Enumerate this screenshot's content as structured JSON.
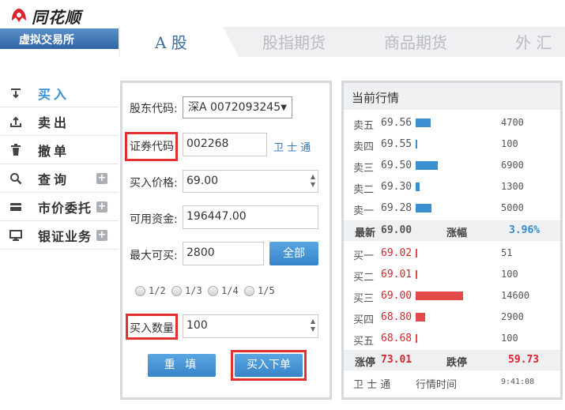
{
  "app": {
    "logo_text": "同花顺",
    "subtitle": "虚拟交易所"
  },
  "tabs": [
    {
      "label": "A  股",
      "active": true
    },
    {
      "label": "股指期货",
      "active": false
    },
    {
      "label": "商品期货",
      "active": false
    },
    {
      "label": "外  汇",
      "active": false
    }
  ],
  "sidebar": {
    "items": [
      {
        "label": "买入",
        "icon": "download-icon",
        "active": true
      },
      {
        "label": "卖出",
        "icon": "upload-icon",
        "active": false
      },
      {
        "label": "撤单",
        "icon": "trash-icon",
        "active": false
      },
      {
        "label": "查询",
        "icon": "search-icon",
        "expandable": true
      },
      {
        "label": "市价委托",
        "icon": "card-icon",
        "expandable": true
      },
      {
        "label": "银证业务",
        "icon": "monitor-icon",
        "expandable": true
      }
    ],
    "plus_symbol": "+"
  },
  "form": {
    "account_label": "股东代码:",
    "account_value": "深A 0072093245",
    "code_label": "证券代码",
    "code_value": "002268",
    "stock_name": "卫 士 通",
    "price_label": "买入价格:",
    "price_value": "69.00",
    "funds_label": "可用资金:",
    "funds_value": "196447.00",
    "max_label": "最大可买:",
    "max_value": "2800",
    "all_button": "全部",
    "fractions": [
      "1/2",
      "1/3",
      "1/4",
      "1/5"
    ],
    "qty_label": "买入数量",
    "qty_value": "100",
    "reset_button": "重  填",
    "submit_button": "买入下单"
  },
  "quote": {
    "title": "当前行情",
    "asks": [
      {
        "label": "卖五",
        "price": "69.56",
        "volume": "4700",
        "bar": 0.32
      },
      {
        "label": "卖四",
        "price": "69.55",
        "volume": "100",
        "bar": 0.03
      },
      {
        "label": "卖三",
        "price": "69.50",
        "volume": "6900",
        "bar": 0.47
      },
      {
        "label": "卖二",
        "price": "69.30",
        "volume": "1300",
        "bar": 0.09
      },
      {
        "label": "卖一",
        "price": "69.28",
        "volume": "5000",
        "bar": 0.34
      }
    ],
    "latest_label": "最新",
    "latest_value": "69.00",
    "change_label": "涨幅",
    "change_value": "3.96%",
    "bids": [
      {
        "label": "买一",
        "price": "69.02",
        "volume": "51",
        "bar": 0.01
      },
      {
        "label": "买二",
        "price": "69.01",
        "volume": "100",
        "bar": 0.01
      },
      {
        "label": "买三",
        "price": "69.00",
        "volume": "14600",
        "bar": 1.0
      },
      {
        "label": "买四",
        "price": "68.80",
        "volume": "2900",
        "bar": 0.2
      },
      {
        "label": "买五",
        "price": "68.68",
        "volume": "100",
        "bar": 0.01
      }
    ],
    "limit_up_label": "涨停",
    "limit_up_value": "73.01",
    "limit_down_label": "跌停",
    "limit_down_value": "59.73",
    "footer_name": "卫 士 通",
    "footer_time_label": "行情时间",
    "footer_time": "9:41:08"
  },
  "colors": {
    "ask_bar": "#3a8fd0",
    "bid_bar": "#e54a4a",
    "red_price": "#d8232a",
    "blue_pct": "#2e8bd0"
  }
}
